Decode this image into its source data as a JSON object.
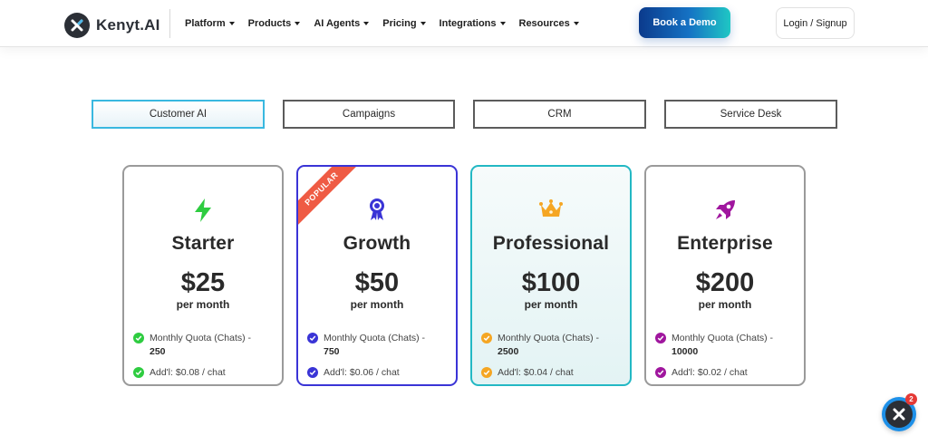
{
  "brand": {
    "name": "Kenyt.AI"
  },
  "nav": {
    "items": [
      {
        "label": "Platform"
      },
      {
        "label": "Products"
      },
      {
        "label": "AI Agents"
      },
      {
        "label": "Pricing"
      },
      {
        "label": "Integrations"
      },
      {
        "label": "Resources"
      }
    ],
    "demo_label": "Book a Demo",
    "login_label": "Login / Signup"
  },
  "tabs": [
    {
      "label": "Customer AI",
      "active": true
    },
    {
      "label": "Campaigns",
      "active": false
    },
    {
      "label": "CRM",
      "active": false
    },
    {
      "label": "Service Desk",
      "active": false
    }
  ],
  "plans": [
    {
      "name": "Starter",
      "price": "$25",
      "period": "per month",
      "icon": "lightning-icon",
      "color": "#2ecc40",
      "quota_label": "Monthly Quota (Chats) -",
      "quota_value": "250",
      "addl": "Add'l: $0.08 / chat"
    },
    {
      "name": "Growth",
      "price": "$50",
      "period": "per month",
      "icon": "award-ribbon-icon",
      "color": "#3a34d6",
      "quota_label": "Monthly Quota (Chats) -",
      "quota_value": "750",
      "addl": "Add'l: $0.06 / chat",
      "ribbon": "POPULAR"
    },
    {
      "name": "Professional",
      "price": "$100",
      "period": "per month",
      "icon": "crown-icon",
      "color": "#f5a623",
      "quota_label": "Monthly Quota (Chats) -",
      "quota_value": "2500",
      "addl": "Add'l: $0.04 / chat"
    },
    {
      "name": "Enterprise",
      "price": "$200",
      "period": "per month",
      "icon": "rocket-icon",
      "color": "#a0169e",
      "quota_label": "Monthly Quota (Chats) -",
      "quota_value": "10000",
      "addl": "Add'l: $0.02 / chat"
    }
  ],
  "chat_widget": {
    "badge": "2"
  }
}
